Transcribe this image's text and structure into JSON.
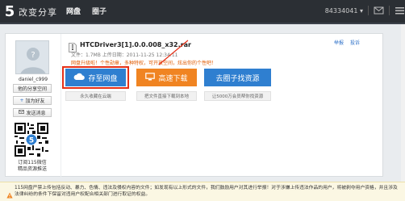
{
  "header": {
    "logo_num": "5",
    "logo_text": "改变分享",
    "nav": [
      {
        "label": "网盘",
        "active": true
      },
      {
        "label": "圈子",
        "active": false
      }
    ],
    "user_id": "84334041",
    "dropdown_arrow": "▾"
  },
  "sidebar": {
    "username": "daniel_c999",
    "buttons": [
      {
        "label": "他的分享空间"
      },
      {
        "label": "加为好友",
        "prefix": "+"
      },
      {
        "label": "发送消息"
      }
    ],
    "qr_caption_line1": "订阅115微信",
    "qr_caption_line2": "精品资源推送"
  },
  "file": {
    "name": "HTCDriver3[1].0.0.008_x32.rar",
    "meta": "文件：1.7MB    上传日期：2011-11-25 12:34:11",
    "warning": "网盘升级啦！个性勋章，多种特权，可开放空间，炫出你的个性吧！",
    "links": [
      "举报",
      "投诉"
    ]
  },
  "actions": [
    {
      "label": "存至网盘",
      "icon": "cloud-icon",
      "sub": "永久收藏在云端"
    },
    {
      "label": "高速下载",
      "icon": "computer-icon",
      "sub": "把文件直接下载到本地"
    },
    {
      "label": "去圈子找资源",
      "icon": "",
      "sub": "让5000万会员帮你找资源"
    }
  ],
  "notice": {
    "text": "115网盘严禁上传包括反动、暴力、色情、违法及侵权内容的文件；如发现有以上形式的文件，我们鼓励用户对其进行举报！对于涉嫌上传违法作品的用户，将被剥夺用户资格，并且涉及法律纠纷的条件下保留对违用户权配合相关部门进行取证的权益。"
  },
  "colors": {
    "topbar": "#2b2f34",
    "primary_blue": "#2f7fd0",
    "orange": "#f08422",
    "highlight_red": "#e53017",
    "warning_text": "#e05a00"
  }
}
